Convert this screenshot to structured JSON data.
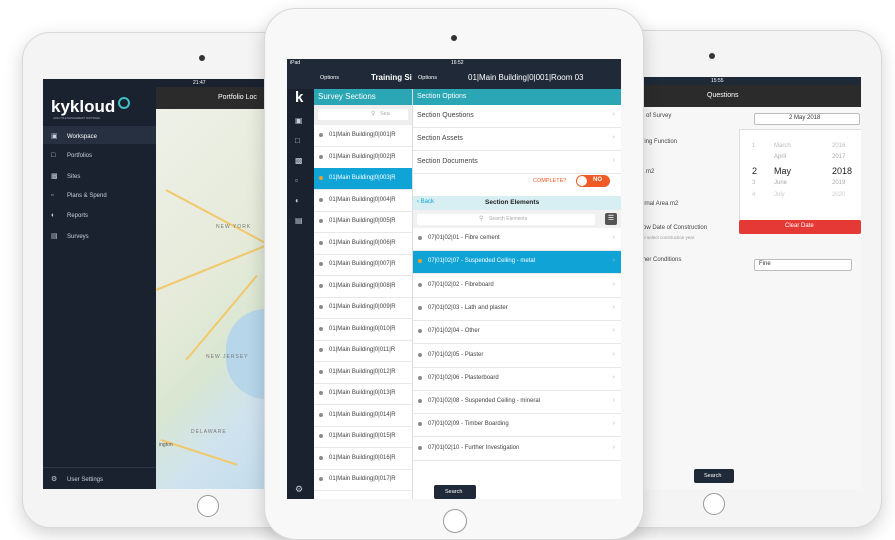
{
  "left": {
    "status_left": "iPad",
    "status_time": "21:47",
    "brand": "kykloud",
    "brand_sub": "LIFECYCLE MANAGEMENT SOFTWARE",
    "header_title": "Portfolio Loc",
    "nav": [
      {
        "label": "Workspace",
        "icon": "book-icon"
      },
      {
        "label": "Portfolios",
        "icon": "folder-icon"
      },
      {
        "label": "Sites",
        "icon": "building-icon"
      },
      {
        "label": "Plans & Spend",
        "icon": "plans-icon"
      },
      {
        "label": "Reports",
        "icon": "pie-icon"
      },
      {
        "label": "Surveys",
        "icon": "clipboard-icon"
      }
    ],
    "footer_user": "User Settings",
    "map_labels": {
      "city": "NEW YORK",
      "state": "NEW JERSEY",
      "bay": "DELAWARE",
      "town": "ington"
    }
  },
  "center": {
    "status_left": "iPad",
    "status_time": "16:52",
    "left_options": "Options",
    "left_title": "Training Si",
    "right_options": "Options",
    "right_title": "01|Main Building|0|001|Room 03",
    "survey_sections_label": "Survey Sections",
    "search_placeholder": "Sea",
    "sections": [
      "01|Main Building|0|001|R",
      "01|Main Building|0|002|R",
      "01|Main Building|0|003|R",
      "01|Main Building|0|004|R",
      "01|Main Building|0|005|R",
      "01|Main Building|0|006|R",
      "01|Main Building|0|007|R",
      "01|Main Building|0|008|R",
      "01|Main Building|0|009|R",
      "01|Main Building|0|010|R",
      "01|Main Building|0|011|R",
      "01|Main Building|0|012|R",
      "01|Main Building|0|013|R",
      "01|Main Building|0|014|R",
      "01|Main Building|0|015|R",
      "01|Main Building|0|016|R",
      "01|Main Building|0|017|R"
    ],
    "selected_section_index": 2,
    "section_options_label": "Section Options",
    "options": [
      "Section Questions",
      "Section Assets",
      "Section Documents"
    ],
    "complete_label": "COMPLETE?",
    "toggle_label": "NO",
    "back_label": "Back",
    "elements_title": "Section Elements",
    "elements_search_placeholder": "Search Elements",
    "elements": [
      "07|01|02|01 - Fibre cement",
      "07|01|02|07 - Suspended Ceiling - metal",
      "07|01|02|02 - Fibreboard",
      "07|01|02|03 - Lath and plaster",
      "07|01|02|04 - Other",
      "07|01|02|05 - Plaster",
      "07|01|02|06 - Plasterboard",
      "07|01|02|08 - Suspended Ceiling - mineral",
      "07|01|02|09 - Timber Boarding",
      "07|01|02|10 - Further Investigation"
    ],
    "selected_element_index": 1,
    "search_button": "Search"
  },
  "right": {
    "status_time": "15:55",
    "header_title": "Questions",
    "q_survey": "e of Survey",
    "survey_date": "2 May 2018",
    "q_function": "ding Function",
    "q_area": "a m2",
    "q_internal": "ernal Area m2",
    "q_construction": "row Date of Construction",
    "q_construction_hint": "se select construction year",
    "q_conditions": "ther Conditions",
    "conditions_value": "Fine",
    "picker_days": [
      "1",
      "2",
      "3",
      "4"
    ],
    "picker_months": [
      "March",
      "April",
      "May",
      "June",
      "July"
    ],
    "picker_years": [
      "2016",
      "2017",
      "2018",
      "2019",
      "2020"
    ],
    "clear_date": "Clear Date",
    "search_button": "Search"
  },
  "colors": {
    "accent": "#2aa6b4",
    "selected": "#0fa3d6",
    "toggle": "#f05a24",
    "danger": "#e53935",
    "nav": "#1f2937"
  }
}
